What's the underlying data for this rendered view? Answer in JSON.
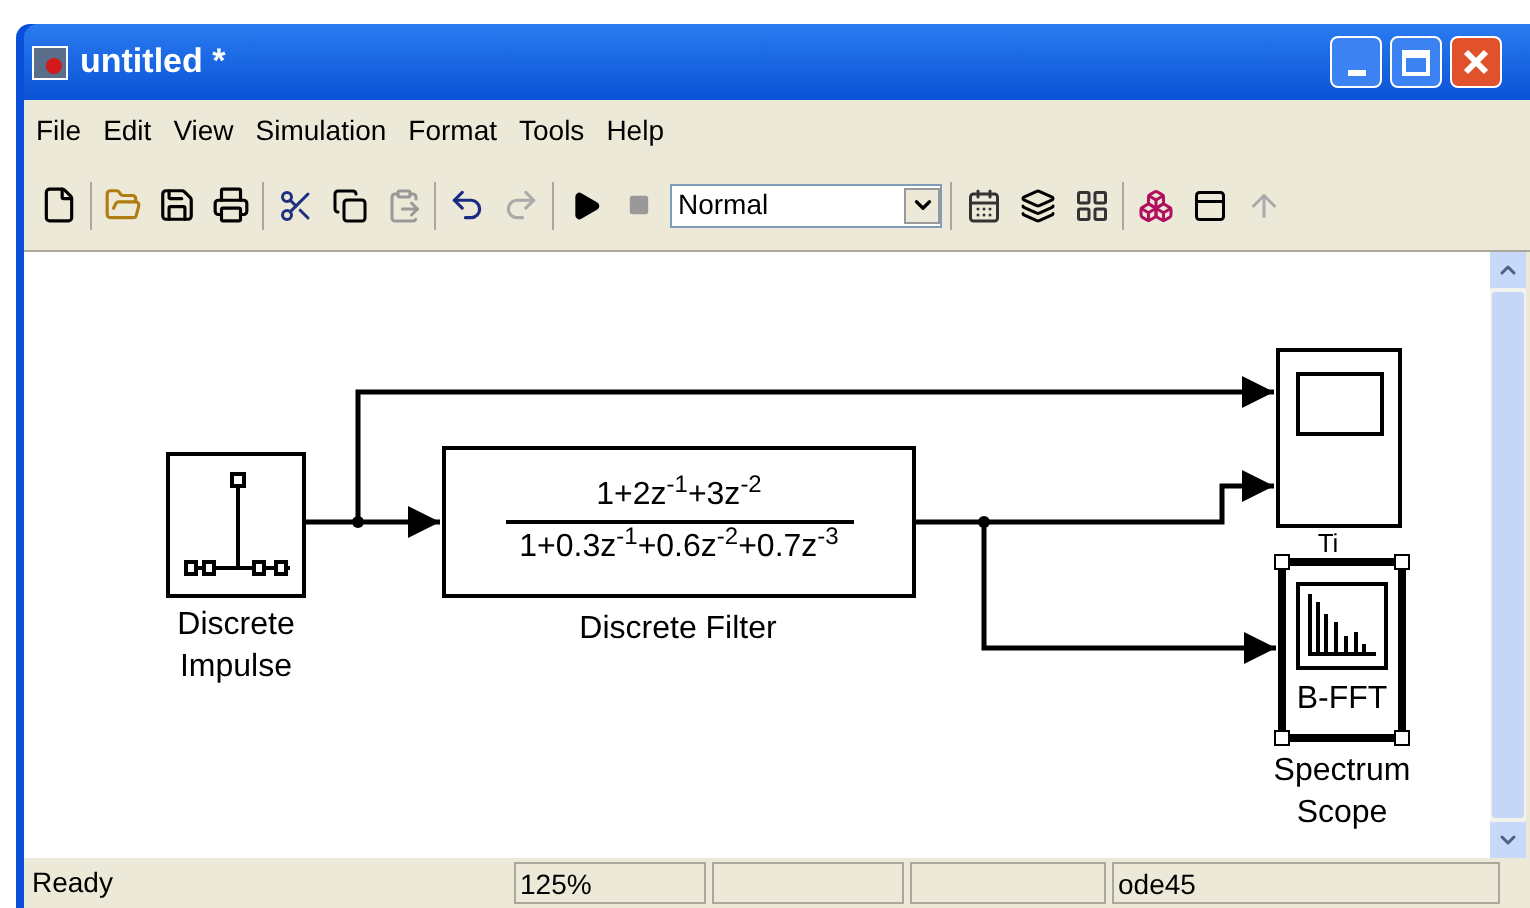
{
  "window": {
    "title": "untitled *"
  },
  "menu": [
    {
      "label": "File"
    },
    {
      "label": "Edit"
    },
    {
      "label": "View"
    },
    {
      "label": "Simulation"
    },
    {
      "label": "Format"
    },
    {
      "label": "Tools"
    },
    {
      "label": "Help"
    }
  ],
  "toolbar": {
    "simulation_mode": "Normal"
  },
  "diagram": {
    "blocks": [
      {
        "kind": "impulse",
        "label_lines": [
          "Discrete",
          "Impulse"
        ],
        "selected": false
      },
      {
        "kind": "filter",
        "numerator": "1+2z$^{-1}$+3z$^{-2}$",
        "denominator": "1+0.3z$^{-1}$+0.6z$^{-2}$+0.7z$^{-3}$",
        "label_lines": [
          "Discrete Filter"
        ],
        "selected": false
      },
      {
        "kind": "scope",
        "label_lines": [
          "Ti"
        ],
        "selected": false
      },
      {
        "kind": "spectrum",
        "caption": "B-FFT",
        "label_lines": [
          "Spectrum",
          "Scope"
        ],
        "selected": true
      }
    ]
  },
  "status_bar": {
    "message": "Ready",
    "zoom": "125%",
    "solver": "ode45"
  }
}
